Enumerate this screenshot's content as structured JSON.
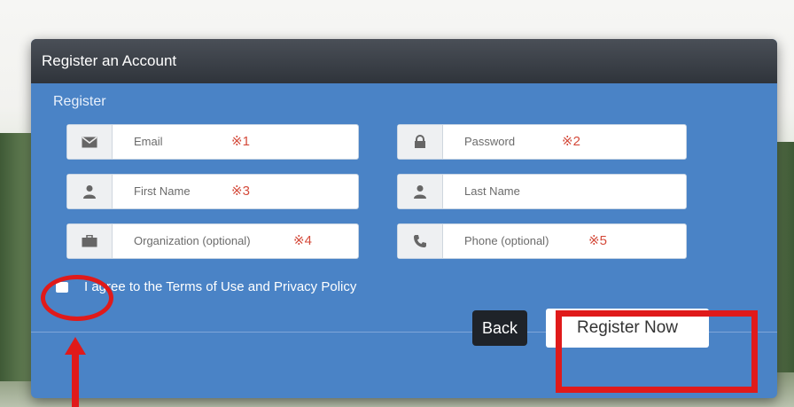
{
  "dialog": {
    "title": "Register an Account",
    "legend": "Register"
  },
  "fields": {
    "email": {
      "placeholder": "Email",
      "note": "※1",
      "icon": "envelope-icon"
    },
    "password": {
      "placeholder": "Password",
      "note": "※2",
      "icon": "lock-icon"
    },
    "first_name": {
      "placeholder": "First Name",
      "note": "※3",
      "icon": "user-icon"
    },
    "last_name": {
      "placeholder": "Last Name",
      "note": "",
      "icon": "user-icon"
    },
    "organization": {
      "placeholder": "Organization (optional)",
      "note": "※4",
      "icon": "briefcase-icon"
    },
    "phone": {
      "placeholder": "Phone (optional)",
      "note": "※5",
      "icon": "phone-icon"
    }
  },
  "terms": {
    "label": "I agree to the Terms of Use and Privacy Policy",
    "checked": false
  },
  "buttons": {
    "back": "Back",
    "register": "Register Now"
  },
  "colors": {
    "panel": "#4a83c6",
    "header": "#2f343b",
    "annotation": "#e01a1a",
    "note": "#d44a3a"
  }
}
